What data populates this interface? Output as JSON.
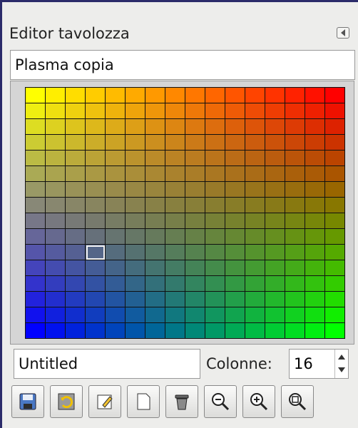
{
  "panel": {
    "title": "Editor tavolozza",
    "palette_name": "Plasma copia"
  },
  "grid": {
    "columns": 16,
    "rows": 16,
    "selected_row": 10,
    "selected_col": 3
  },
  "bottom": {
    "entry_name": "Untitled",
    "columns_label": "Colonne:",
    "columns_value": "16"
  },
  "toolbar": {
    "buttons": [
      {
        "icon": "save-icon"
      },
      {
        "icon": "revert-icon"
      },
      {
        "icon": "edit-icon"
      },
      {
        "icon": "new-color-icon"
      },
      {
        "icon": "delete-icon"
      },
      {
        "icon": "zoom-out-icon"
      },
      {
        "icon": "zoom-in-icon"
      },
      {
        "icon": "zoom-fit-icon"
      }
    ]
  },
  "colors": {
    "top_left": "#ffff00",
    "top_right": "#ff0000",
    "bottom_left": "#0000ff",
    "bottom_right": "#00ff00"
  }
}
